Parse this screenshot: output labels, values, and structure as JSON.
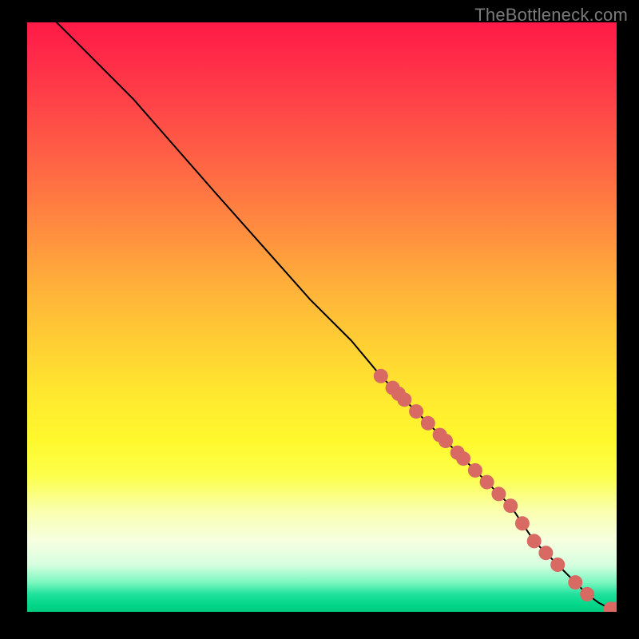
{
  "watermark": "TheBottleneck.com",
  "colors": {
    "dot": "#d86a63",
    "line": "#000000",
    "frame_bg": "#000000"
  },
  "chart_data": {
    "type": "line",
    "title": "",
    "xlabel": "",
    "ylabel": "",
    "xlim": [
      0,
      100
    ],
    "ylim": [
      0,
      100
    ],
    "grid": false,
    "note": "Monotonic bottleneck curve descending from (~5,100) to (100,0). X in relative percent along horizontal axis, Y in relative percent of bottleneck. Data markers highlight points between x≈60 and x≈100.",
    "curve": {
      "x": [
        5,
        8,
        12,
        18,
        25,
        32,
        40,
        48,
        55,
        60,
        63,
        65,
        67,
        69,
        70,
        72,
        73,
        75,
        76,
        78,
        80,
        82,
        84,
        86,
        88,
        90,
        93,
        95,
        97,
        99,
        100
      ],
      "y": [
        100,
        97,
        93,
        87,
        79,
        71,
        62,
        53,
        46,
        40,
        37,
        35,
        33,
        31,
        30,
        28,
        27,
        25,
        24,
        22,
        20,
        18,
        15,
        12,
        10,
        8,
        5,
        3,
        1.5,
        0.5,
        0.5
      ]
    },
    "markers": {
      "x": [
        60,
        62,
        63,
        64,
        66,
        68,
        70,
        71,
        73,
        74,
        76,
        78,
        80,
        82,
        84,
        86,
        88,
        90,
        93,
        95,
        99,
        100
      ],
      "y": [
        40,
        38,
        37,
        36,
        34,
        32,
        30,
        29,
        27,
        26,
        24,
        22,
        20,
        18,
        15,
        12,
        10,
        8,
        5,
        3,
        0.5,
        0.5
      ]
    }
  }
}
